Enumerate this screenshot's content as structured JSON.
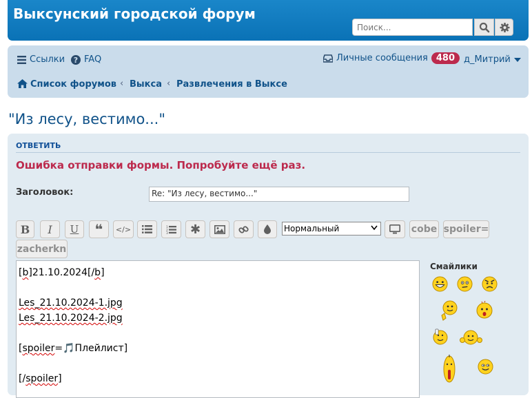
{
  "header": {
    "site_title": "Выксунский городской форум",
    "search_placeholder": "Поиск...",
    "icons": [
      "search-icon",
      "gear-icon"
    ],
    "brand_color": "#0a72b6"
  },
  "navbar": {
    "links_label": "Ссылки",
    "faq_label": "FAQ",
    "pm_label": "Личные сообщения",
    "pm_count": "480",
    "username": "д_Митрий",
    "breadcrumbs": [
      "Список форумов",
      "Выкса",
      "Развлечения в Выксе"
    ]
  },
  "topic": {
    "title": "\"Из лесу, вестимо...\""
  },
  "form": {
    "section_heading": "ОТВЕТИТЬ",
    "error_message": "Ошибка отправки формы. Попробуйте ещё раз.",
    "subject_label": "Заголовок:",
    "subject_value": "Re: \"Из лесу, вестимо...\"",
    "toolbar": {
      "bold": "B",
      "italic": "I",
      "underline": "U",
      "quote": "❝",
      "code": "</>",
      "font_size_selected": "Нормальный",
      "custom": [
        "cobe",
        "spoiler=",
        "zacherkn"
      ]
    },
    "editor_lines": [
      "[b]21.10.2024[/b]",
      "",
      "Les_21.10.2024-1.jpg",
      "Les_21.10.2024-2.jpg",
      "",
      "[spoiler=🎵Плейлист]",
      "",
      "[/spoiler]"
    ],
    "smilies_heading": "Смайлики",
    "accent_error_color": "#bc2a4d"
  }
}
